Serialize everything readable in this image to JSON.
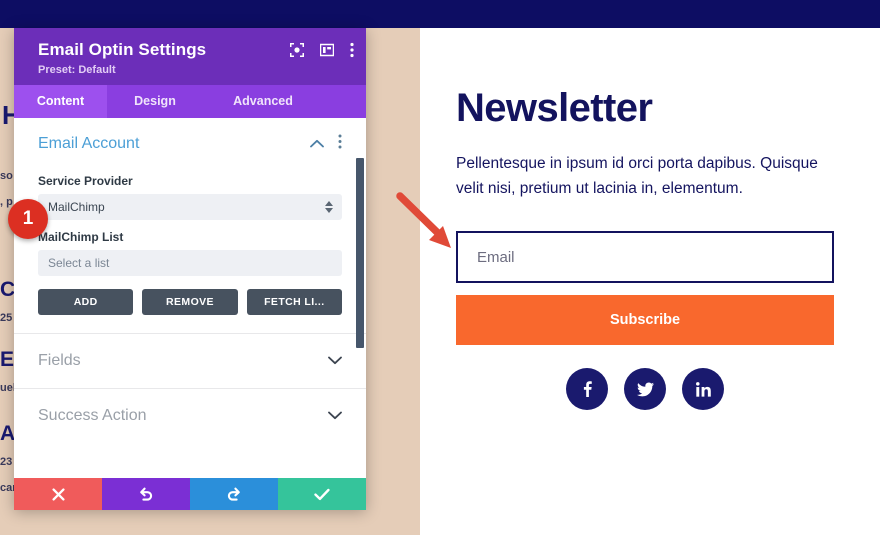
{
  "modal": {
    "title": "Email Optin Settings",
    "preset": "Preset: Default",
    "header_icons": [
      {
        "name": "focus-icon"
      },
      {
        "name": "layout-icon"
      },
      {
        "name": "more-vertical-icon"
      }
    ],
    "tabs": [
      {
        "label": "Content",
        "active": true
      },
      {
        "label": "Design",
        "active": false
      },
      {
        "label": "Advanced",
        "active": false
      }
    ],
    "section": {
      "title": "Email Account",
      "service_provider_label": "Service Provider",
      "service_provider_value": "MailChimp",
      "list_label": "MailChimp List",
      "list_placeholder": "Select a list",
      "buttons": [
        "ADD",
        "REMOVE",
        "FETCH LI..."
      ]
    },
    "collapsed_sections": [
      {
        "label": "Fields"
      },
      {
        "label": "Success Action"
      }
    ],
    "footer_buttons": [
      {
        "name": "cancel",
        "icon": "close-icon",
        "color": "#f05b5b"
      },
      {
        "name": "undo",
        "icon": "undo-icon",
        "color": "#7b2fd4"
      },
      {
        "name": "redo",
        "icon": "redo-icon",
        "color": "#2b8fda"
      },
      {
        "name": "save",
        "icon": "check-icon",
        "color": "#35c49b"
      }
    ]
  },
  "annotation": {
    "step_number": "1"
  },
  "newsletter": {
    "title": "Newsletter",
    "description": "Pellentesque in ipsum id orci porta dapibus. Quisque velit nisi, pretium ut lacinia in, elementum.",
    "email_placeholder": "Email",
    "submit_label": "Subscribe",
    "socials": [
      {
        "name": "facebook-icon"
      },
      {
        "name": "twitter-icon"
      },
      {
        "name": "linkedin-icon"
      }
    ]
  },
  "background_text": {
    "l1": "H",
    "l2": "so",
    "l3": ", p",
    "l4": "Co",
    "l5": "25",
    "l6": "Em",
    "l7": "uel",
    "l8": "Ad",
    "l9": "23",
    "l10": "car"
  },
  "colors": {
    "modal_header": "#6c2eb9",
    "tab_active": "#9d50ee",
    "accent_orange": "#f9682d",
    "navy": "#13135e",
    "page_bg": "#e5cdb8",
    "badge_red": "#dc2f22"
  }
}
